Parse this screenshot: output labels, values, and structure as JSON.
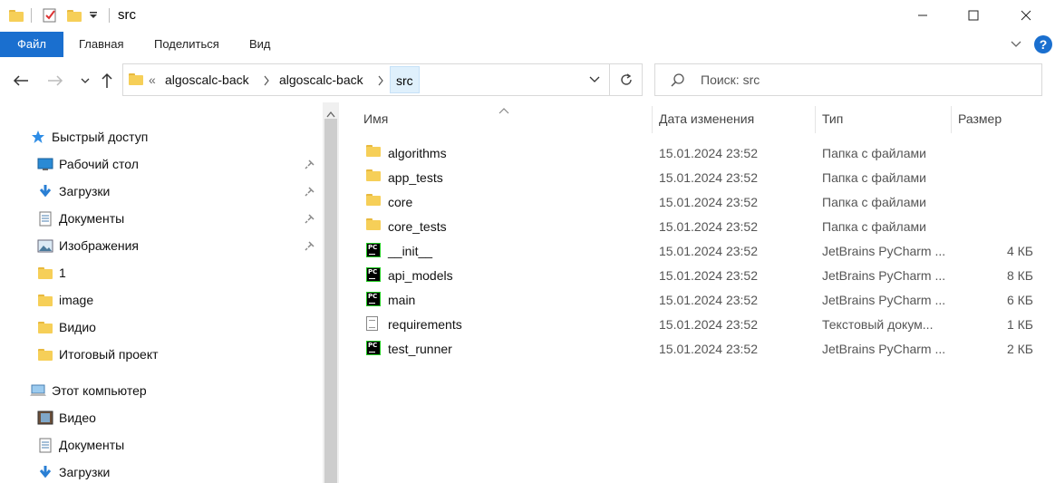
{
  "window": {
    "title": "src"
  },
  "ribbon": {
    "tabs": [
      "Файл",
      "Главная",
      "Поделиться",
      "Вид"
    ],
    "help": "?"
  },
  "address": {
    "overflow": "«",
    "segments": [
      "algoscalc-back",
      "algoscalc-back",
      "src"
    ]
  },
  "search": {
    "placeholder": "Поиск: src"
  },
  "sidebar": {
    "quick_access": "Быстрый доступ",
    "pinned": [
      {
        "label": "Рабочий стол",
        "icon": "desktop-icon"
      },
      {
        "label": "Загрузки",
        "icon": "download-icon"
      },
      {
        "label": "Документы",
        "icon": "documents-icon"
      },
      {
        "label": "Изображения",
        "icon": "pictures-icon"
      }
    ],
    "folders": [
      "1",
      "image",
      "Видио",
      "Итоговый проект"
    ],
    "this_pc": "Этот компьютер",
    "pc_items": [
      {
        "label": "Видео",
        "icon": "video-icon"
      },
      {
        "label": "Документы",
        "icon": "documents-icon"
      },
      {
        "label": "Загрузки",
        "icon": "download-icon"
      }
    ]
  },
  "columns": {
    "name": "Имя",
    "date": "Дата изменения",
    "type": "Тип",
    "size": "Размер"
  },
  "files": [
    {
      "name": "algorithms",
      "date": "15.01.2024 23:52",
      "type": "Папка с файлами",
      "size": "",
      "icon": "folder"
    },
    {
      "name": "app_tests",
      "date": "15.01.2024 23:52",
      "type": "Папка с файлами",
      "size": "",
      "icon": "folder"
    },
    {
      "name": "core",
      "date": "15.01.2024 23:52",
      "type": "Папка с файлами",
      "size": "",
      "icon": "folder"
    },
    {
      "name": "core_tests",
      "date": "15.01.2024 23:52",
      "type": "Папка с файлами",
      "size": "",
      "icon": "folder"
    },
    {
      "name": "__init__",
      "date": "15.01.2024 23:52",
      "type": "JetBrains PyCharm ...",
      "size": "4 КБ",
      "icon": "pycharm"
    },
    {
      "name": "api_models",
      "date": "15.01.2024 23:52",
      "type": "JetBrains PyCharm ...",
      "size": "8 КБ",
      "icon": "pycharm"
    },
    {
      "name": "main",
      "date": "15.01.2024 23:52",
      "type": "JetBrains PyCharm ...",
      "size": "6 КБ",
      "icon": "pycharm"
    },
    {
      "name": "requirements",
      "date": "15.01.2024 23:52",
      "type": "Текстовый докум...",
      "size": "1 КБ",
      "icon": "text"
    },
    {
      "name": "test_runner",
      "date": "15.01.2024 23:52",
      "type": "JetBrains PyCharm ...",
      "size": "2 КБ",
      "icon": "pycharm"
    }
  ]
}
